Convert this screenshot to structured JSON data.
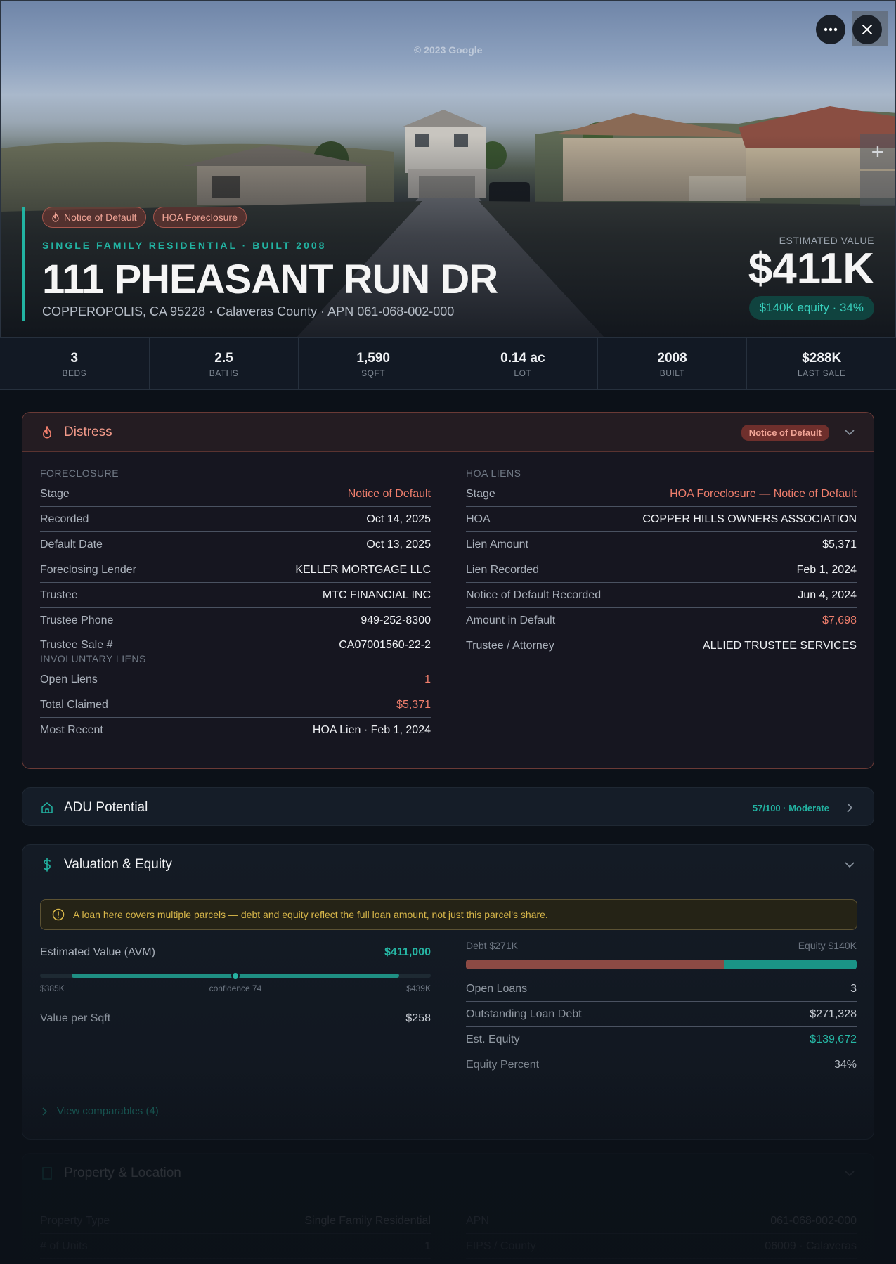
{
  "hero": {
    "watermark": "© 2023 Google",
    "badges": [
      {
        "label": "Notice of Default",
        "icon": "flame-icon"
      },
      {
        "label": "HOA Foreclosure"
      }
    ],
    "subtitle": "SINGLE FAMILY RESIDENTIAL · BUILT 2008",
    "address": "111 PHEASANT RUN DR",
    "address_line": "COPPEROPOLIS, CA 95228 · Calaveras County · APN 061-068-002-000",
    "value_label": "ESTIMATED VALUE",
    "value": "$411K",
    "equity": "$140K equity · 34%",
    "more_icon": "more-horizontal-icon",
    "close_icon": "close-icon",
    "zoom_in": "+"
  },
  "stats": [
    {
      "value": "3",
      "label": "BEDS"
    },
    {
      "value": "2.5",
      "label": "BATHS"
    },
    {
      "value": "1,590",
      "label": "SQFT"
    },
    {
      "value": "0.14 ac",
      "label": "LOT"
    },
    {
      "value": "2008",
      "label": "BUILT"
    },
    {
      "value": "$288K",
      "label": "LAST SALE"
    }
  ],
  "distress": {
    "title": "Distress",
    "badge": "Notice of Default",
    "foreclosure": {
      "label": "FORECLOSURE",
      "rows": [
        {
          "k": "Stage",
          "v": "Notice of Default"
        },
        {
          "k": "Recorded",
          "v": "Oct 14, 2025"
        },
        {
          "k": "Default Date",
          "v": "Oct 13, 2025"
        },
        {
          "k": "Foreclosing Lender",
          "v": "KELLER MORTGAGE LLC"
        },
        {
          "k": "Trustee",
          "v": "MTC FINANCIAL INC"
        },
        {
          "k": "Trustee Phone",
          "v": "949-252-8300"
        },
        {
          "k": "Trustee Sale #",
          "v": "CA07001560-22-2"
        }
      ]
    },
    "involuntary": {
      "label": "INVOLUNTARY LIENS",
      "rows": [
        {
          "k": "Open Liens",
          "v": "1"
        },
        {
          "k": "Total Claimed",
          "v": "$5,371"
        },
        {
          "k": "Most Recent",
          "v": "HOA Lien · Feb 1, 2024"
        }
      ]
    },
    "hoa": {
      "label": "HOA LIENS",
      "rows": [
        {
          "k": "Stage",
          "v": "HOA Foreclosure — Notice of Default"
        },
        {
          "k": "HOA",
          "v": "COPPER HILLS OWNERS ASSOCIATION"
        },
        {
          "k": "Lien Amount",
          "v": "$5,371"
        },
        {
          "k": "Lien Recorded",
          "v": "Feb 1, 2024"
        },
        {
          "k": "Notice of Default Recorded",
          "v": "Jun 4, 2024"
        },
        {
          "k": "Amount in Default",
          "v": "$7,698"
        },
        {
          "k": "Trustee / Attorney",
          "v": "ALLIED TRUSTEE SERVICES"
        }
      ]
    }
  },
  "adu": {
    "title": "ADU Potential",
    "score": "57/100 · Moderate"
  },
  "valuation": {
    "title": "Valuation & Equity",
    "notice": "A loan here covers multiple parcels — debt and equity reflect the full loan amount, not just this parcel's share.",
    "avm_label": "Estimated Value (AVM)",
    "avm_value": "$411,000",
    "range_low": "$385K",
    "range_high": "$439K",
    "confidence_label": "confidence 74",
    "confidence": 74,
    "value_per_sqft_label": "Value per Sqft",
    "value_per_sqft": "$258",
    "debt_label": "Debt $271K",
    "equity_label": "Equity $140K",
    "debt_fraction": 0.66,
    "rows": [
      {
        "k": "Open Loans",
        "v": "3"
      },
      {
        "k": "Outstanding Loan Debt",
        "v": "$271,328"
      },
      {
        "k": "Est. Equity",
        "v": "$139,672"
      },
      {
        "k": "Equity Percent",
        "v": "34%"
      }
    ],
    "comparables": "View comparables (4)"
  },
  "property": {
    "title": "Property & Location",
    "rows_left": [
      {
        "k": "Property Type",
        "v": "Single Family Residential"
      },
      {
        "k": "# of Units",
        "v": "1"
      }
    ],
    "rows_right": [
      {
        "k": "APN",
        "v": "061-068-002-000"
      },
      {
        "k": "FIPS / County",
        "v": "06009 · Calaveras"
      }
    ]
  },
  "colors": {
    "accent": "#22b3a2",
    "distress": "#ef7e6c",
    "warning": "#d8b74a"
  }
}
